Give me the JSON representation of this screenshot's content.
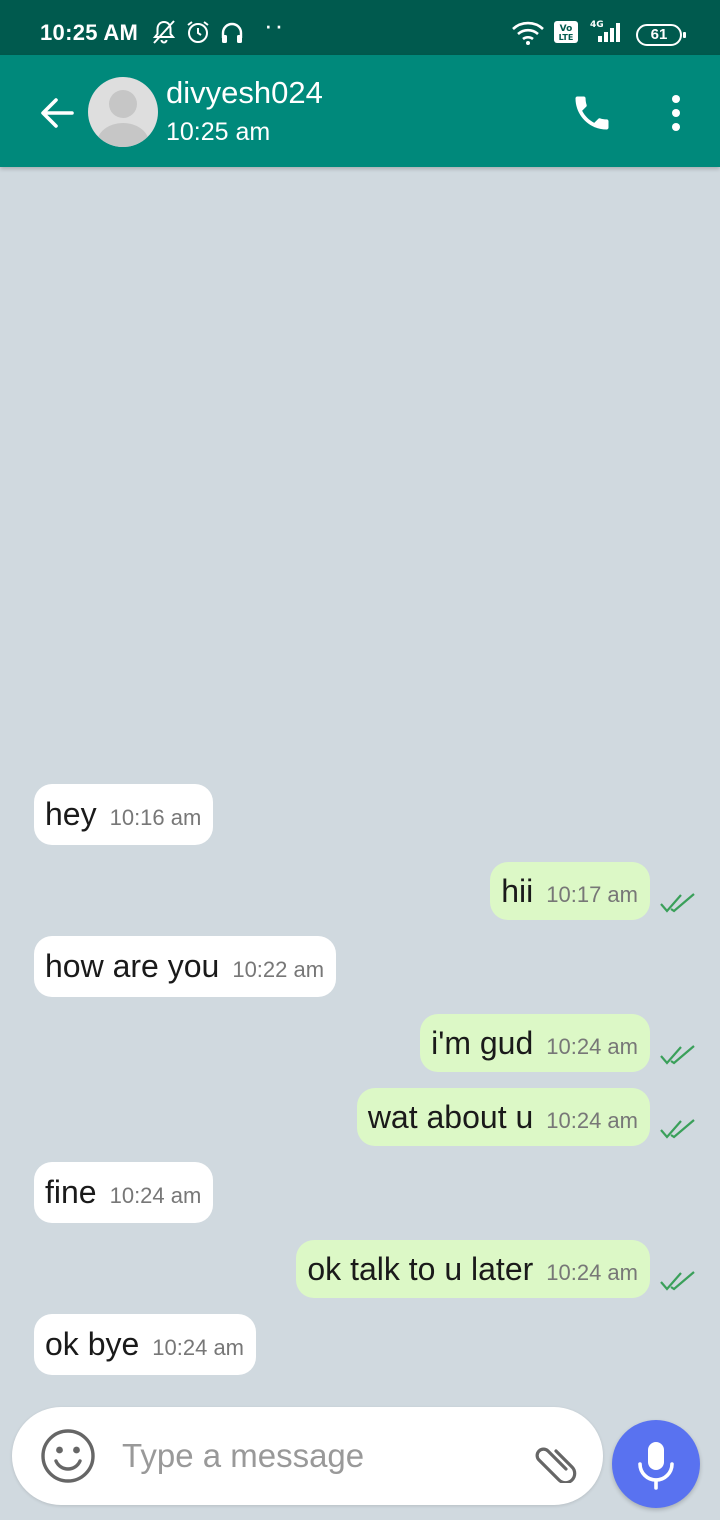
{
  "status_bar": {
    "time": "10:25 AM",
    "dots": "··",
    "battery": "61",
    "icons": [
      "mute-notification-icon",
      "alarm-icon",
      "headphones-icon",
      "wifi-icon",
      "volte-icon",
      "signal-4g-icon",
      "battery-icon"
    ]
  },
  "header": {
    "contact_name": "divyesh024",
    "last_seen": "10:25 am",
    "icons": [
      "back-arrow-icon",
      "avatar-placeholder",
      "phone-call-icon",
      "more-vert-icon"
    ]
  },
  "messages": [
    {
      "direction": "in",
      "text": "hey",
      "time": "10:16 am"
    },
    {
      "direction": "out",
      "text": "hii",
      "time": "10:17 am",
      "status": "read"
    },
    {
      "direction": "in",
      "text": "how are you",
      "time": "10:22 am"
    },
    {
      "direction": "out",
      "text": "i'm gud",
      "time": "10:24 am",
      "status": "read"
    },
    {
      "direction": "out",
      "text": "wat about u",
      "time": "10:24 am",
      "status": "read"
    },
    {
      "direction": "in",
      "text": "fine",
      "time": "10:24 am"
    },
    {
      "direction": "out",
      "text": "ok talk to u later",
      "time": "10:24 am",
      "status": "read"
    },
    {
      "direction": "in",
      "text": "ok bye",
      "time": "10:24 am"
    }
  ],
  "composer": {
    "placeholder": "Type a message",
    "value": "",
    "icons": [
      "emoji-icon",
      "attach-icon",
      "mic-icon"
    ]
  },
  "colors": {
    "status_bar": "#005a4e",
    "app_bar": "#00897b",
    "chat_background": "#d0d9df",
    "incoming_bubble": "#ffffff",
    "outgoing_bubble": "#dcf8c6",
    "read_ticks": "#3aa05a",
    "mic_button": "#5972f0"
  }
}
